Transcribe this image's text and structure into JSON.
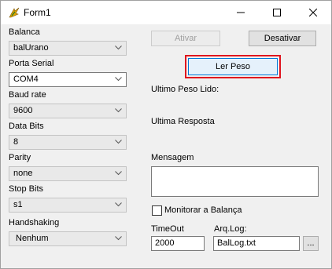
{
  "window": {
    "title": "Form1"
  },
  "left_panel": {
    "balanca": {
      "label": "Balanca",
      "value": "balUrano"
    },
    "porta_serial": {
      "label": "Porta Serial",
      "value": "COM4"
    },
    "baud_rate": {
      "label": "Baud rate",
      "value": "9600"
    },
    "data_bits": {
      "label": "Data Bits",
      "value": "8"
    },
    "parity": {
      "label": "Parity",
      "value": "none"
    },
    "stop_bits": {
      "label": "Stop Bits",
      "value": "s1"
    },
    "handshaking": {
      "label": "Handshaking",
      "value": "Nenhum"
    }
  },
  "right_panel": {
    "ativar_label": "Ativar",
    "desativar_label": "Desativar",
    "ler_peso_label": "Ler Peso",
    "ultimo_peso_label": "Ultimo Peso Lido:",
    "ultima_resposta_label": "Ultima Resposta",
    "mensagem_label": "Mensagem",
    "mensagem_value": "",
    "monitorar_label": "Monitorar a Balança",
    "timeout_label": "TimeOut",
    "timeout_value": "2000",
    "arqlog_label": "Arq.Log:",
    "arqlog_value": "BalLog.txt",
    "browse_label": "..."
  },
  "colors": {
    "highlight": "#e0141e",
    "default_button": "#0078d7"
  },
  "icons": [
    "app-icon",
    "minimize-icon",
    "maximize-icon",
    "close-icon",
    "chevron-down-icon"
  ]
}
